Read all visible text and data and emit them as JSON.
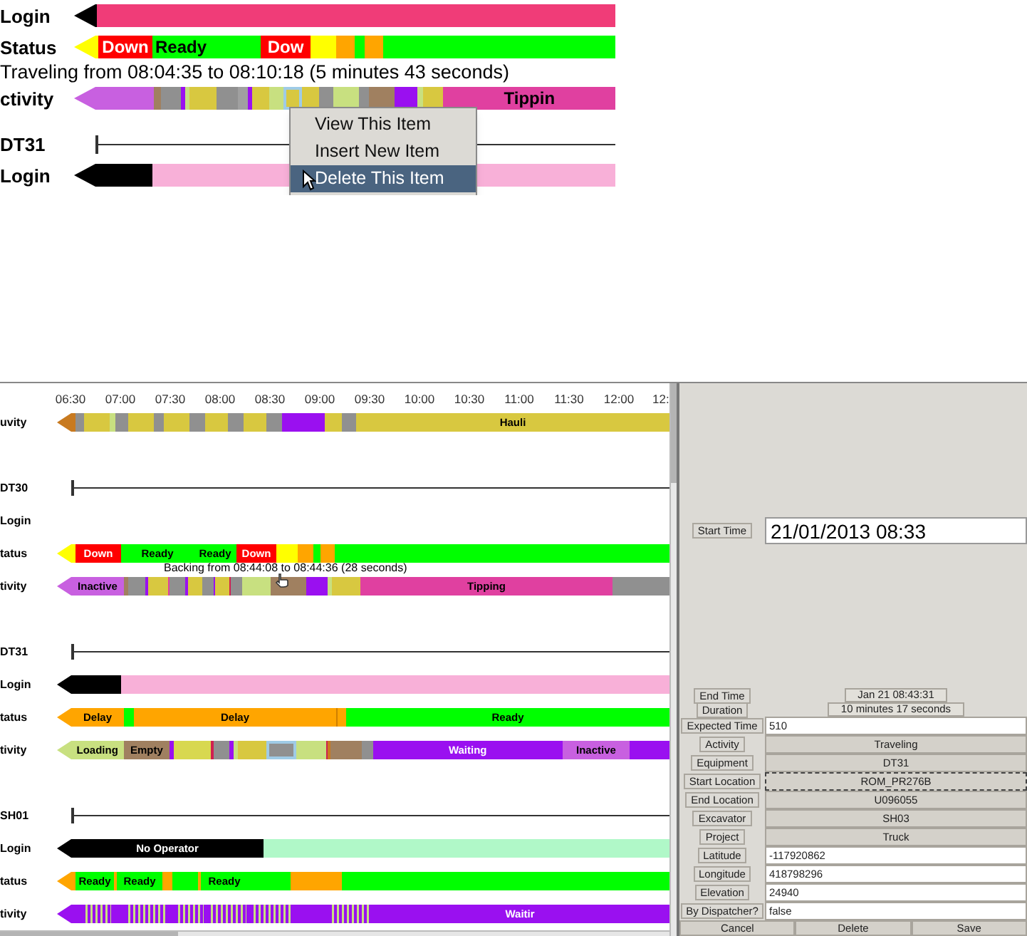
{
  "detail_view": {
    "groups": [
      {
        "rows": [
          {
            "label": "Login",
            "kind": "bar",
            "segments": [
              {
                "color": "#000000"
              },
              {
                "color": "#f03c78"
              }
            ]
          },
          {
            "label": "Status",
            "kind": "bar",
            "segments": [
              {
                "color": "#ffff00"
              },
              {
                "color": "#ff0000",
                "label": "Down"
              },
              {
                "color": "#00ff00",
                "label": "Ready"
              },
              {
                "color": "#00ff00"
              },
              {
                "color": "#ff0000",
                "label": "Dow"
              },
              {
                "color": "#ffff00"
              },
              {
                "color": "#ffa500"
              },
              {
                "color": "#00ff00"
              },
              {
                "color": "#ffa500"
              },
              {
                "color": "#00ff00"
              }
            ]
          },
          {
            "label": "ctivity",
            "kind": "bar",
            "tooltip": "Traveling from 08:04:35 to 08:10:18 (5 minutes 43 seconds)",
            "segments": [
              {
                "color": "#c860e0",
                "selected": false
              },
              {
                "color": "#a08060",
                "selected": false
              },
              {
                "color": "#909090",
                "selected": false
              },
              {
                "color": "#9a10f0",
                "selected": false
              },
              {
                "color": "#c8e080",
                "selected": false
              },
              {
                "color": "#d8c840",
                "selected": false
              },
              {
                "color": "#909090",
                "selected": false
              },
              {
                "color": "#a0a0a0",
                "selected": false
              },
              {
                "color": "#9a10f0",
                "selected": false
              },
              {
                "color": "#d8c840",
                "selected": false
              },
              {
                "color": "#c8e080",
                "selected": false
              },
              {
                "color": "#d8c840",
                "selected": true
              },
              {
                "color": "#d8c840",
                "selected": false
              },
              {
                "color": "#909090",
                "selected": false
              },
              {
                "color": "#c8e080",
                "selected": false
              },
              {
                "color": "#909090",
                "selected": false
              },
              {
                "color": "#a08060",
                "selected": false
              },
              {
                "color": "#9a10f0",
                "selected": false
              },
              {
                "color": "#c8e080",
                "selected": false
              },
              {
                "color": "#d8c840",
                "selected": false
              },
              {
                "color": "#e040a0",
                "label": "Tippin",
                "selected": false
              }
            ]
          }
        ]
      },
      {
        "rows": [
          {
            "label": "DT31",
            "kind": "line"
          },
          {
            "label": "Login",
            "kind": "bar",
            "segments": [
              {
                "color": "#000000"
              },
              {
                "color": "#f8b0d8"
              }
            ]
          }
        ]
      }
    ],
    "context_menu": [
      {
        "label": "View This Item",
        "selected": false
      },
      {
        "label": "Insert New Item",
        "selected": false
      },
      {
        "label": "Delete This Item",
        "selected": true
      }
    ]
  },
  "timeline": {
    "time_labels": [
      "06:30",
      "07:00",
      "07:30",
      "08:00",
      "08:30",
      "09:00",
      "09:30",
      "10:00",
      "10:30",
      "11:00",
      "11:30",
      "12:00",
      "12:"
    ],
    "groups": [
      {
        "rows": [
          {
            "label": "uvity",
            "kind": "bar",
            "segments": [
              {
                "color": "#c87a20"
              },
              {
                "color": "#909090"
              },
              {
                "color": "#d8c840"
              },
              {
                "color": "#c8e080"
              },
              {
                "color": "#909090"
              },
              {
                "color": "#d8c840"
              },
              {
                "color": "#909090"
              },
              {
                "color": "#d8c840"
              },
              {
                "color": "#909090"
              },
              {
                "color": "#d8c840"
              },
              {
                "color": "#909090"
              },
              {
                "color": "#d8c840"
              },
              {
                "color": "#909090"
              },
              {
                "color": "#9a10f0"
              },
              {
                "color": "#d8c840"
              },
              {
                "color": "#909090"
              },
              {
                "color": "#d8c840",
                "label": "Hauli"
              }
            ]
          }
        ]
      },
      {
        "rows": [
          {
            "label": "DT30",
            "kind": "line"
          },
          {
            "label": "Login",
            "kind": "label"
          },
          {
            "label": "tatus",
            "kind": "bar",
            "segments": [
              {
                "color": "#ffff00"
              },
              {
                "color": "#ff0000",
                "label": "Down"
              },
              {
                "color": "#00ff00",
                "label": "Ready"
              },
              {
                "color": "#00ff00",
                "label": "Ready"
              },
              {
                "color": "#ff0000",
                "label": "Down"
              },
              {
                "color": "#ffff00"
              },
              {
                "color": "#ffa500"
              },
              {
                "color": "#00ff00"
              },
              {
                "color": "#ffa500"
              },
              {
                "color": "#00ff00"
              }
            ]
          },
          {
            "label": "tivity",
            "kind": "bar",
            "tooltip": "Backing from 08:44:08 to 08:44:36 (28 seconds)",
            "segments": [
              {
                "color": "#c860e0",
                "label": "Inactive"
              },
              {
                "color": "#a08060"
              },
              {
                "color": "#909090"
              },
              {
                "color": "#9a10f0"
              },
              {
                "color": "#d8c840"
              },
              {
                "color": "#e040a0"
              },
              {
                "color": "#909090"
              },
              {
                "color": "#9a10f0"
              },
              {
                "color": "#d8c840"
              },
              {
                "color": "#909090"
              },
              {
                "color": "#9a10f0"
              },
              {
                "color": "#d8c840"
              },
              {
                "color": "#d02050"
              },
              {
                "color": "#909090"
              },
              {
                "color": "#c8e080"
              },
              {
                "color": "#a08060"
              },
              {
                "color": "#9a10f0"
              },
              {
                "color": "#c8e080"
              },
              {
                "color": "#d8c840"
              },
              {
                "color": "#e040a0",
                "label": "Tipping"
              },
              {
                "color": "#909090"
              }
            ]
          }
        ]
      },
      {
        "rows": [
          {
            "label": "DT31",
            "kind": "line"
          },
          {
            "label": "Login",
            "kind": "bar",
            "segments": [
              {
                "color": "#000000"
              },
              {
                "color": "#f8b0d8"
              }
            ]
          },
          {
            "label": "tatus",
            "kind": "bar",
            "segments": [
              {
                "color": "#ffa500",
                "label": "Delay"
              },
              {
                "color": "#00ff00"
              },
              {
                "color": "#ffa500",
                "label": "Delay"
              },
              {
                "color": "#d08000"
              },
              {
                "color": "#ffa500"
              },
              {
                "color": "#00ff00",
                "label": "Ready"
              }
            ]
          },
          {
            "label": "tivity",
            "kind": "bar",
            "segments": [
              {
                "color": "#c8e080",
                "label": "Loading",
                "selected": false
              },
              {
                "color": "#a08060",
                "label": "Empty",
                "selected": false
              },
              {
                "color": "#9a10f0",
                "selected": false
              },
              {
                "color": "#d8d850",
                "selected": false
              },
              {
                "color": "#d02050",
                "selected": false
              },
              {
                "color": "#909090",
                "selected": false
              },
              {
                "color": "#9a10f0",
                "selected": false
              },
              {
                "color": "#c8e080",
                "selected": false
              },
              {
                "color": "#d8c840",
                "selected": false
              },
              {
                "color": "#909090",
                "selected": true
              },
              {
                "color": "#c8e080",
                "selected": false
              },
              {
                "color": "#d02050",
                "selected": false
              },
              {
                "color": "#c87a20",
                "selected": false
              },
              {
                "color": "#a08060",
                "selected": false
              },
              {
                "color": "#909090",
                "selected": false
              },
              {
                "color": "#9a10f0",
                "label": "Waiting",
                "selected": false
              },
              {
                "color": "#c860e0",
                "label": "Inactive",
                "selected": false
              },
              {
                "color": "#9a10f0",
                "selected": false
              }
            ]
          }
        ]
      },
      {
        "rows": [
          {
            "label": "SH01",
            "kind": "line"
          },
          {
            "label": "Login",
            "kind": "bar",
            "segments": [
              {
                "color": "#000000",
                "label": "No Operator"
              },
              {
                "color": "#b0f8c8"
              }
            ]
          },
          {
            "label": "tatus",
            "kind": "bar",
            "segments": [
              {
                "color": "#ffa500"
              },
              {
                "color": "#00ff00",
                "label": "Ready"
              },
              {
                "color": "#ffa500"
              },
              {
                "color": "#00ff00",
                "label": "Ready"
              },
              {
                "color": "#ffa500"
              },
              {
                "color": "#00ff00"
              },
              {
                "color": "#ffa500"
              },
              {
                "color": "#00ff00",
                "label": "Ready"
              },
              {
                "color": "#00ff00"
              },
              {
                "color": "#ffa500"
              },
              {
                "color": "#00ff00"
              }
            ]
          },
          {
            "label": "tivity",
            "kind": "bar",
            "segments": [
              {
                "kind": "solid",
                "color": "#9a10f0"
              },
              {
                "kind": "striped",
                "color": "#9a10f0"
              },
              {
                "kind": "solid",
                "color": "#9a10f0"
              },
              {
                "kind": "striped",
                "color": "#9a10f0"
              },
              {
                "kind": "solid",
                "color": "#9a10f0"
              },
              {
                "kind": "striped",
                "color": "#9a10f0"
              },
              {
                "kind": "solid",
                "color": "#9a10f0"
              },
              {
                "kind": "striped",
                "color": "#9a10f0"
              },
              {
                "kind": "solid",
                "color": "#9a10f0"
              },
              {
                "kind": "striped",
                "color": "#9a10f0"
              },
              {
                "kind": "solid",
                "color": "#9a10f0"
              },
              {
                "kind": "striped",
                "color": "#9a10f0"
              },
              {
                "kind": "solid",
                "color": "#9a10f0",
                "label": "Waitir"
              }
            ]
          }
        ]
      }
    ]
  },
  "details_form": {
    "start_time": {
      "label": "Start Time",
      "value": "21/01/2013 08:33"
    },
    "fields": [
      {
        "label": "End Time",
        "kind": "readout",
        "value": "Jan 21 08:43:31",
        "focused": false
      },
      {
        "label": "Duration",
        "kind": "readout",
        "value": "10 minutes 17 seconds",
        "focused": false
      },
      {
        "label": "Expected Time",
        "kind": "input",
        "value": "510",
        "focused": false
      },
      {
        "label": "Activity",
        "kind": "choice",
        "value": "Traveling",
        "focused": false
      },
      {
        "label": "Equipment",
        "kind": "choice",
        "value": "DT31",
        "focused": false
      },
      {
        "label": "Start Location",
        "kind": "choice",
        "value": "ROM_PR276B",
        "focused": true
      },
      {
        "label": "End Location",
        "kind": "choice",
        "value": "U096055",
        "focused": false
      },
      {
        "label": "Excavator",
        "kind": "choice",
        "value": "SH03",
        "focused": false
      },
      {
        "label": "Project",
        "kind": "choice",
        "value": "Truck",
        "focused": false
      },
      {
        "label": "Latitude",
        "kind": "input",
        "value": "-117920862",
        "focused": false
      },
      {
        "label": "Longitude",
        "kind": "input",
        "value": "418798296",
        "focused": false
      },
      {
        "label": "Elevation",
        "kind": "input",
        "value": "24940",
        "focused": false
      },
      {
        "label": "By Dispatcher?",
        "kind": "input",
        "value": "false",
        "focused": false
      }
    ],
    "buttons": [
      "Cancel",
      "Delete",
      "Save"
    ]
  }
}
